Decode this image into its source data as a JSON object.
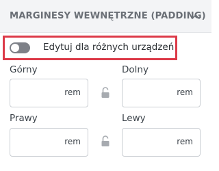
{
  "panel": {
    "title": "MARGINESY WEWNĘTRZNE (PADDING)"
  },
  "toggle": {
    "label": "Edytuj dla różnych urządzeń",
    "state": "off"
  },
  "fields": {
    "top": {
      "label": "Górny",
      "value": "",
      "unit": "rem"
    },
    "bottom": {
      "label": "Dolny",
      "value": "",
      "unit": "rem"
    },
    "right": {
      "label": "Prawy",
      "value": "",
      "unit": "rem"
    },
    "left": {
      "label": "Lewy",
      "value": "",
      "unit": "rem"
    }
  },
  "icons": {
    "collapse": "chevron-up-icon",
    "lock": "unlocked-padlock-icon"
  },
  "colors": {
    "highlight_border": "#dc3a48",
    "toggle_off": "#7e8188",
    "header_bg": "#f3f4f6"
  }
}
